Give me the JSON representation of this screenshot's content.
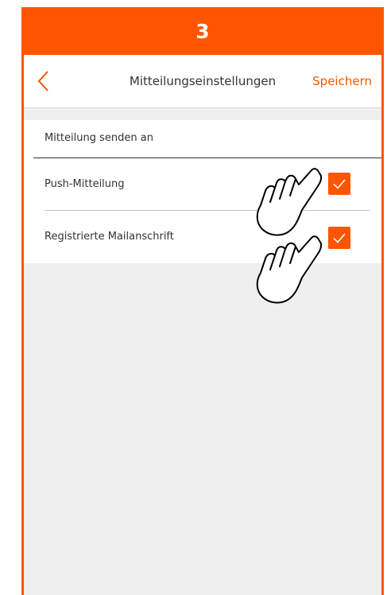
{
  "step": {
    "number": "3"
  },
  "nav": {
    "title": "Mitteilungseinstellungen",
    "save_label": "Speichern",
    "back_icon": "chevron-left-icon"
  },
  "section": {
    "header": "Mitteilung senden an"
  },
  "options": [
    {
      "label": "Push-Mitteilung",
      "checked": true
    },
    {
      "label": "Registrierte Mailanschrift",
      "checked": true
    }
  ],
  "colors": {
    "accent": "#FF5500",
    "background": "#EFEFEF",
    "text": "#333333"
  }
}
